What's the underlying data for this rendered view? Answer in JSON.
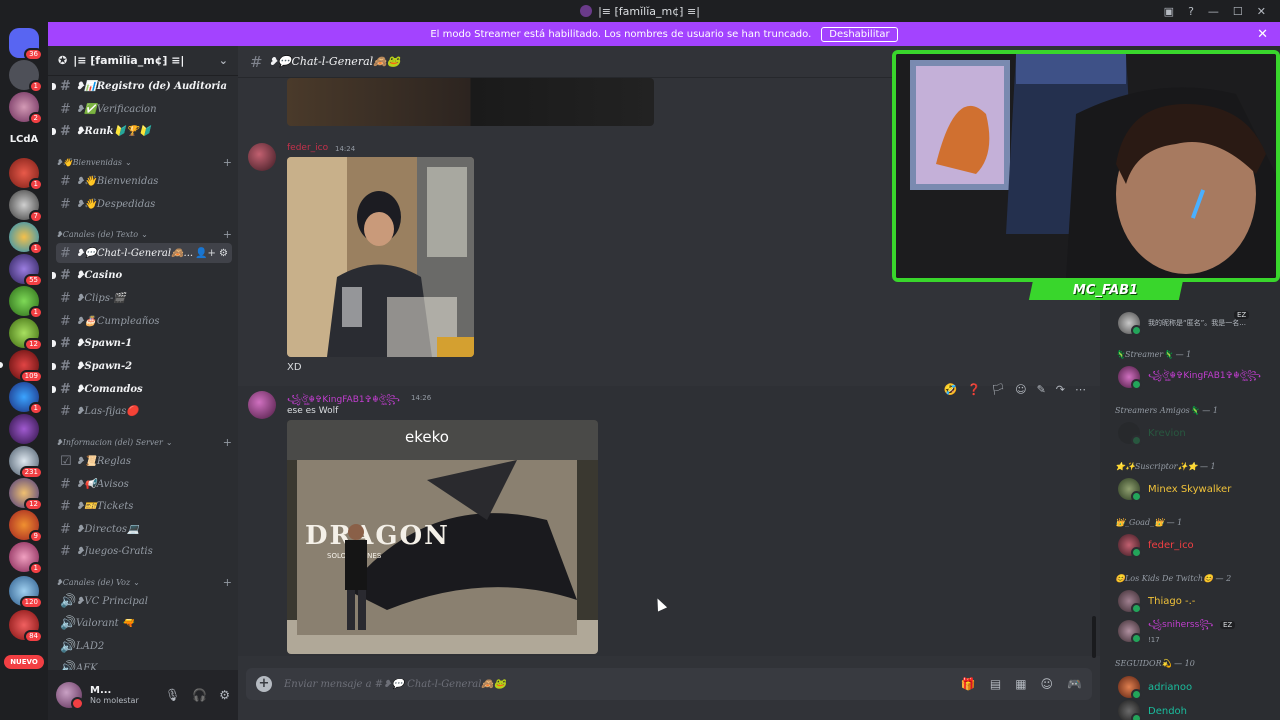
{
  "window": {
    "title": "|≡ ⁅famĭlĭa_m¢⁆ ≡|",
    "controls": [
      "minimize-icon",
      "maximize-icon",
      "close-icon"
    ]
  },
  "banner": {
    "text": "El modo Streamer está habilitado. Los nombres de usuario se han truncado.",
    "button": "Deshabilitar"
  },
  "rail": {
    "badges": [
      "36",
      "1",
      "2",
      "1",
      "7",
      "1",
      "55",
      "1",
      "12",
      "109",
      "1",
      "231",
      "12",
      "9",
      "1",
      "120",
      "84"
    ],
    "lcda": "LCdA",
    "nuevo": "NUEVO"
  },
  "guild": {
    "name": "|≡ ⁅famĭlĭa_m¢⁆ ≡|",
    "channels": [
      {
        "label": "❥📊Registro (de) Auditoria",
        "unread": true
      },
      {
        "label": "❥✅Verificacion",
        "unread": false
      },
      {
        "label": "❥Rank🔰🏆🔰",
        "unread": true
      }
    ],
    "cat_bienvenidas": "❥👋Bienvenidas",
    "bienvenidas": [
      {
        "label": "❥👋Bienvenidas"
      },
      {
        "label": "❥👋Despedidas"
      }
    ],
    "cat_texto": "❥Canales (de) Texto",
    "texto": [
      {
        "label": "❥💬Chat-l-General🙈...",
        "active": true
      },
      {
        "label": "❥Casino",
        "unread": true
      },
      {
        "label": "❥Clips-🎬",
        "unread": false
      },
      {
        "label": "❥🎂Cumpleaños",
        "unread": false
      },
      {
        "label": "❥Spawn-1",
        "unread": true
      },
      {
        "label": "❥Spawn-2",
        "unread": true
      },
      {
        "label": "❥Comandos",
        "unread": true
      },
      {
        "label": "❥Las-fijas🔴",
        "unread": false
      }
    ],
    "cat_info": "❥Informacion (del) Server",
    "info": [
      {
        "label": "❥📜Reglas"
      },
      {
        "label": "❥📢Avisos"
      },
      {
        "label": "❥🎫Tickets"
      },
      {
        "label": "❥Directos💻"
      },
      {
        "label": "❥Juegos-Gratis"
      }
    ],
    "cat_voz": "❥Canales (de) Voz",
    "voz": [
      {
        "label": "❥VC Principal"
      },
      {
        "label": "Valorant 🔫"
      },
      {
        "label": "LAD2"
      },
      {
        "label": "AFK"
      }
    ]
  },
  "user": {
    "name": "M...",
    "status": "No molestar"
  },
  "channel": {
    "title": "❥💬Chat-l-General🙈🐸"
  },
  "messages": [
    {
      "author": "feder_ico",
      "time": "14:24",
      "text": "XD"
    },
    {
      "author": "꧁ঔৣ☬✞KingFAB1✞☬ঔৣ꧂",
      "time": "14:26",
      "text": "ese es Wolf",
      "poster_brand": "ekeko",
      "poster_title": "DRAGON",
      "poster_sub": "SOLO EN CINES"
    }
  ],
  "composer": {
    "placeholder": "Enviar mensaje a #❥💬 Chat-l-General🙈🐸"
  },
  "members": {
    "top_text": "我的昵称是“匿名”。我是一名...",
    "groups": [
      {
        "name": "🦎Streamer🦎 — 1",
        "items": [
          {
            "name": "꧁ঔৣ☬✞KingFAB1✞☬ঔৣ꧂"
          }
        ]
      },
      {
        "name": "Streamers Amigos🦎 — 1",
        "items": [
          {
            "name": "Krevion"
          }
        ]
      },
      {
        "name": "⭐✨Suscriptor✨⭐ — 1",
        "items": [
          {
            "name": "Minex Skywalker"
          }
        ]
      },
      {
        "name": "👑_Goad_👑 — 1",
        "items": [
          {
            "name": "feder_ico"
          }
        ]
      },
      {
        "name": "😊Los Kids De Twitch😊 — 2",
        "items": [
          {
            "name": "Thiago -.-"
          },
          {
            "name": "꧁sniherss꧂",
            "sub": "!17"
          }
        ]
      },
      {
        "name": "SEGUIDOR💫 — 10",
        "items": [
          {
            "name": "adrianoo"
          },
          {
            "name": "Dendoh"
          }
        ]
      }
    ],
    "ez_badge": "EZ"
  },
  "cam": {
    "name": "MC_FAB1"
  },
  "colors": {
    "accent": "#a343ff",
    "cam_green": "#39d62c",
    "mention_red": "#c4314b",
    "magenta": "#c13ecf"
  }
}
